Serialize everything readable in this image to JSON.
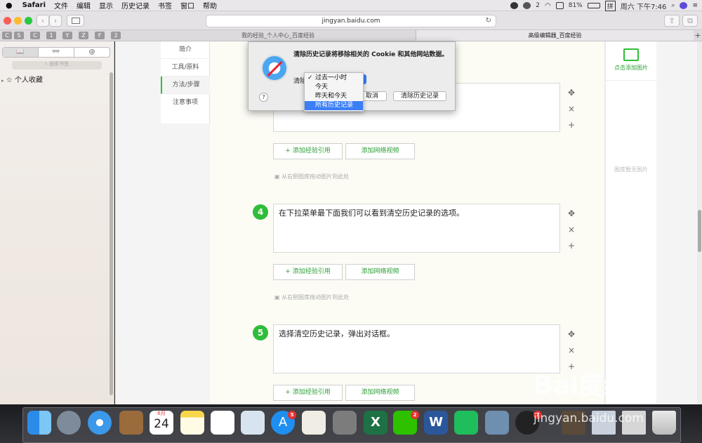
{
  "menubar": {
    "apple": "",
    "app": "Safari",
    "items": [
      "文件",
      "编辑",
      "显示",
      "历史记录",
      "书签",
      "窗口",
      "帮助"
    ],
    "status": {
      "wechat_count": "2",
      "battery": "81%",
      "input_method": "拼",
      "clock": "周六 下午7:46"
    }
  },
  "toolbar": {
    "url": "jingyan.baidu.com",
    "back": "‹",
    "forward": "›"
  },
  "favorites": [
    "C",
    "S",
    "C",
    "1",
    "Y",
    "Z",
    "F",
    "2"
  ],
  "tabs": [
    {
      "label": "我的经验_个人中心_百度经验"
    },
    {
      "label": "高级编辑器_百度经验"
    }
  ],
  "sidebar": {
    "segments": [
      "📖",
      "👓",
      "@"
    ],
    "search_placeholder": "搜索书签",
    "item_personal": "个人收藏"
  },
  "leftnav": {
    "items": [
      "简介",
      "工具/原料",
      "方法/步骤",
      "注意事项"
    ]
  },
  "steps": [
    {
      "number": "4",
      "text": "在下拉菜单最下面我们可以看到清空历史记录的选项。"
    },
    {
      "number": "5",
      "text": "选择清空历史记录，弹出对话框。"
    }
  ],
  "buttons": {
    "add_ref": "+ 添加经验引用",
    "add_video": "添加网络视频"
  },
  "drag_hint": "从右侧图库拖动图片到此处",
  "controls": {
    "move": "✥",
    "delete": "×",
    "add": "+"
  },
  "rightpanel": {
    "add_image": "点击添加图片",
    "empty": "图库暂无图片"
  },
  "dialog": {
    "message": "清除历史记录将移除相关的 Cookie 和其他网站数据。",
    "clear_label": "清除",
    "help": "?",
    "cancel": "取消",
    "confirm": "清除历史记录"
  },
  "dropdown": {
    "options": [
      "过去一小时",
      "今天",
      "昨天和今天",
      "所有历史记录"
    ],
    "checked_index": 0,
    "highlight_index": 3
  },
  "dock": {
    "calendar_month": "6月",
    "calendar_day": "24",
    "badges": {
      "appstore": "5",
      "wechat": "2",
      "qq": "7"
    }
  },
  "watermark": {
    "brand": "Bai度经验",
    "url": "jingyan.baidu.com"
  },
  "colors": {
    "accent_green": "#2fbd3a",
    "dropdown_highlight": "#3b7ef5",
    "link_green": "#2a9e34"
  }
}
